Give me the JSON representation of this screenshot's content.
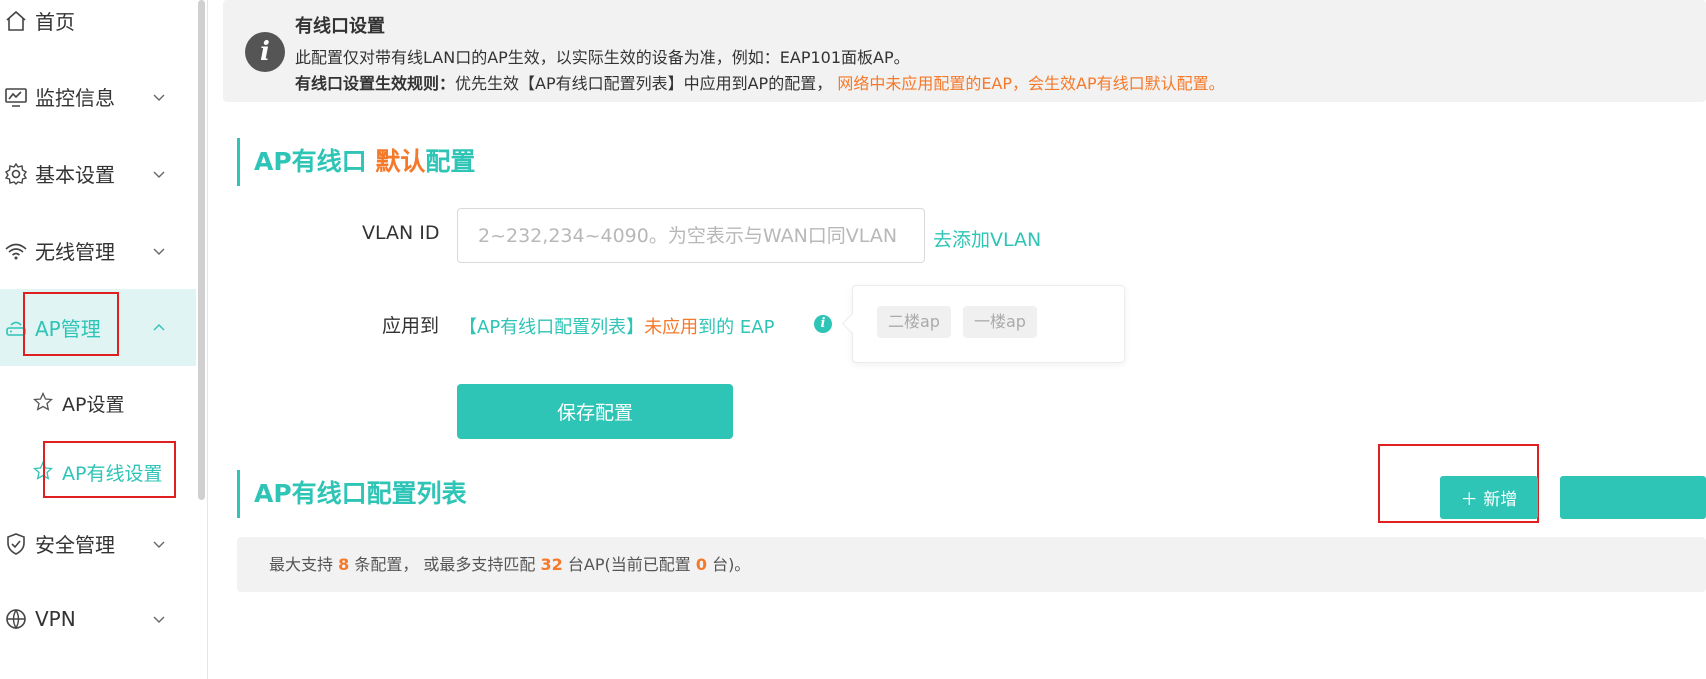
{
  "sidebar": {
    "items": [
      {
        "label": "首页",
        "icon": "home-icon"
      },
      {
        "label": "监控信息",
        "icon": "monitor-icon"
      },
      {
        "label": "基本设置",
        "icon": "gear-icon"
      },
      {
        "label": "无线管理",
        "icon": "wifi-gear-icon"
      },
      {
        "label": "AP管理",
        "icon": "ap-icon"
      },
      {
        "label": "安全管理",
        "icon": "shield-icon"
      },
      {
        "label": "VPN",
        "icon": "vpn-icon"
      }
    ],
    "sub_items": [
      {
        "label": "AP设置",
        "icon": "star-icon"
      },
      {
        "label": "AP有线设置",
        "icon": "star-icon"
      }
    ]
  },
  "notice": {
    "title": "有线口设置",
    "line1": "此配置仅对带有线LAN口的AP生效，以实际生效的设备为准，例如：EAP101面板AP。",
    "rule_label": "有线口设置生效规则：",
    "rule_text": "优先生效【AP有线口配置列表】中应用到AP的配置，",
    "rule_warn": "网络中未应用配置的EAP，会生效AP有线口默认配置。"
  },
  "default_config": {
    "title_part1": "AP有线口 ",
    "title_part2": "默认",
    "title_part3": "配置",
    "vlan_label": "VLAN ID",
    "vlan_placeholder": "2~232,234~4090。为空表示与WAN口同VLAN",
    "add_vlan_link": "去添加VLAN",
    "apply_label": "应用到",
    "apply_text1": "【AP有线口配置列表】",
    "apply_text2": "未应用",
    "apply_text3": "到的 EAP",
    "help_glyph": "i",
    "tags": [
      "二楼ap",
      "一楼ap"
    ],
    "save_label": "保存配置"
  },
  "config_list": {
    "title": "AP有线口配置列表",
    "add_label": "＋ 新增",
    "info_prefix": "最大支持",
    "max_configs": "8",
    "info_mid1": "条配置， 或最多支持匹配",
    "max_aps": "32",
    "info_mid2": "台AP(当前已配置",
    "current": "0",
    "info_suffix": "台)。"
  },
  "notice_icon_glyph": "i",
  "colors": {
    "accent": "#2ec4b6",
    "warn": "#f5792a",
    "highlight_box": "#e02020"
  }
}
